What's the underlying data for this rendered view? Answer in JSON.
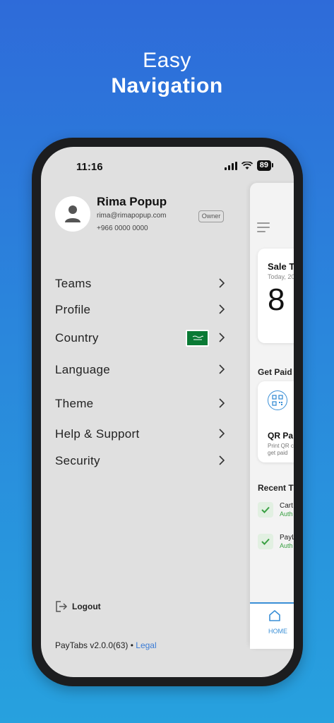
{
  "hero": {
    "line1": "Easy",
    "line2": "Navigation"
  },
  "status": {
    "time": "11:16",
    "battery": "89"
  },
  "profile": {
    "name": "Rima Popup",
    "email": "rima@rimapopup.com",
    "phone": "+966 0000 0000",
    "role_badge": "Owner"
  },
  "menu": {
    "items": [
      {
        "label": "Teams"
      },
      {
        "label": "Profile"
      },
      {
        "label": "Country",
        "flag": "saudi-flag-icon"
      },
      {
        "label": "Language"
      },
      {
        "label": "Theme"
      },
      {
        "label": "Help & Support"
      },
      {
        "label": "Security"
      }
    ]
  },
  "logout_label": "Logout",
  "footer": {
    "version": "PayTabs v2.0.0(63)",
    "separator": "•",
    "legal": "Legal"
  },
  "peek": {
    "sale_title": "Sale T",
    "sale_subtitle": "Today, 20",
    "sale_value": "8",
    "get_paid": "Get Paid",
    "qr_title": "QR Pa",
    "qr_desc_line1": "Print QR c",
    "qr_desc_line2": "get paid",
    "recent": "Recent T",
    "transactions": [
      {
        "name": "Cart",
        "status": "Auth"
      },
      {
        "name": "PayL",
        "status": "Auth"
      }
    ],
    "tab_home": "HOME"
  },
  "colors": {
    "accent": "#3a8fd6",
    "success": "#3aa043",
    "link": "#3a7bd5"
  }
}
